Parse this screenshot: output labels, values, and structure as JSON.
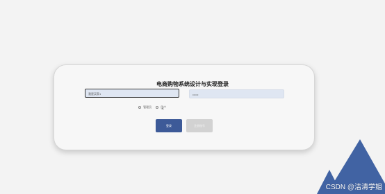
{
  "form": {
    "title": "电商购物系统设计与实现登录",
    "username_value": "我是买家1",
    "password_value": "••••••",
    "roles": [
      {
        "label": "管理员"
      },
      {
        "label": "用户"
      }
    ],
    "login_label": "登录",
    "register_label": "注册账号"
  },
  "decor": {
    "mountain_color": "#4163a3",
    "watermark": "CSDN @洁清学姐"
  }
}
